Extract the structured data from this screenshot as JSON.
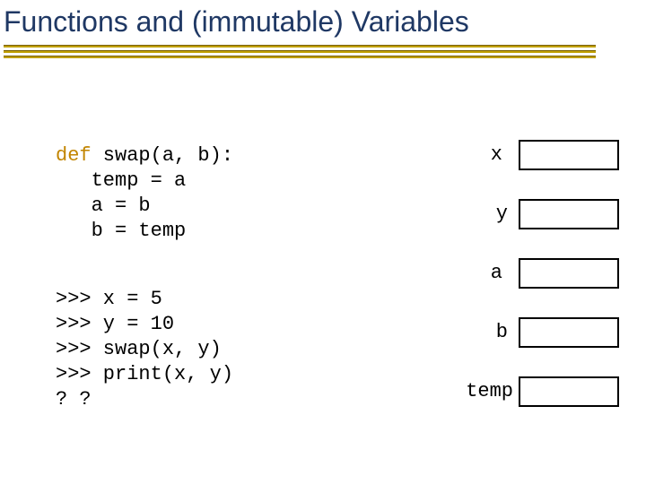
{
  "title": "Functions and (immutable) Variables",
  "code": {
    "kw_def": "def",
    "fn_sig": " swap(a, b):",
    "l2": "   temp = a",
    "l3": "   a = b",
    "l4": "   b = temp"
  },
  "repl": {
    "l1": ">>> x = 5",
    "l2": ">>> y = 10",
    "l3": ">>> swap(x, y)",
    "l4": ">>> print(x, y)",
    "l5": "? ?"
  },
  "vars": {
    "x": "x",
    "y": "y",
    "a": "a",
    "b": "b",
    "temp": "temp"
  }
}
